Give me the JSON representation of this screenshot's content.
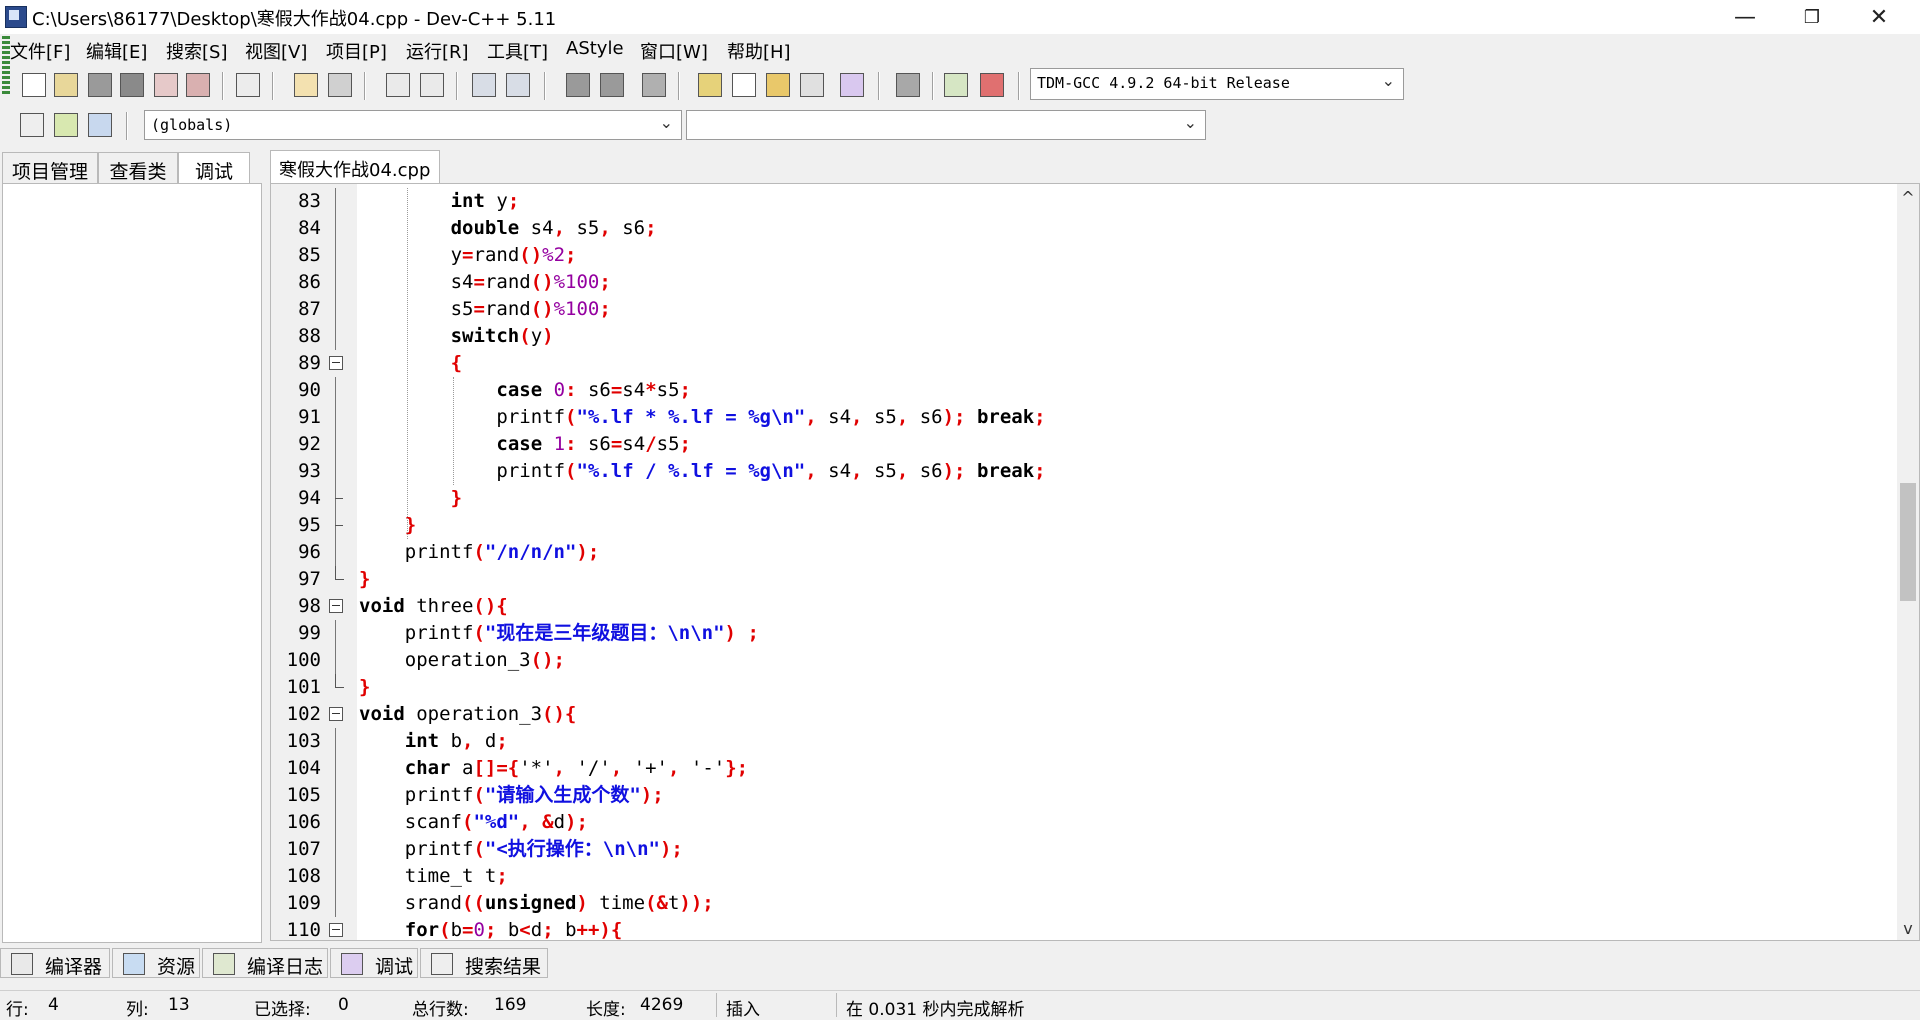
{
  "window": {
    "title": "C:\\Users\\86177\\Desktop\\寒假大作战04.cpp - Dev-C++ 5.11",
    "min_glyph": "—",
    "max_glyph": "❐",
    "close_glyph": "✕"
  },
  "menu": [
    "文件[F]",
    "编辑[E]",
    "搜索[S]",
    "视图[V]",
    "项目[P]",
    "运行[R]",
    "工具[T]",
    "AStyle",
    "窗口[W]",
    "帮助[H]"
  ],
  "toolbar": {
    "compiler_select": "TDM-GCC 4.9.2 64-bit Release",
    "scope_select": "(globals)",
    "member_select": ""
  },
  "left_tabs": [
    "项目管理",
    "查看类",
    "调试"
  ],
  "left_active_tab": 2,
  "editor_tab": "寒假大作战04.cpp",
  "code": [
    {
      "n": "83",
      "t": [
        [
          "kw",
          "int"
        ],
        [
          "id",
          " y"
        ],
        [
          "pu",
          ";"
        ]
      ]
    },
    {
      "n": "84",
      "t": [
        [
          "kw",
          "double"
        ],
        [
          "id",
          " s4"
        ],
        [
          "pu",
          ","
        ],
        [
          "id",
          " s5"
        ],
        [
          "pu",
          ","
        ],
        [
          "id",
          " s6"
        ],
        [
          "pu",
          ";"
        ]
      ]
    },
    {
      "n": "85",
      "t": [
        [
          "id",
          "y"
        ],
        [
          "pu",
          "="
        ],
        [
          "id",
          "rand"
        ],
        [
          "pu",
          "()"
        ],
        [
          "nu",
          "%2"
        ],
        [
          "pu",
          ";"
        ]
      ]
    },
    {
      "n": "86",
      "t": [
        [
          "id",
          "s4"
        ],
        [
          "pu",
          "="
        ],
        [
          "id",
          "rand"
        ],
        [
          "pu",
          "()"
        ],
        [
          "nu",
          "%100"
        ],
        [
          "pu",
          ";"
        ]
      ]
    },
    {
      "n": "87",
      "t": [
        [
          "id",
          "s5"
        ],
        [
          "pu",
          "="
        ],
        [
          "id",
          "rand"
        ],
        [
          "pu",
          "()"
        ],
        [
          "nu",
          "%100"
        ],
        [
          "pu",
          ";"
        ]
      ]
    },
    {
      "n": "88",
      "t": [
        [
          "kw",
          "switch"
        ],
        [
          "pu",
          "("
        ],
        [
          "id",
          "y"
        ],
        [
          "pu",
          ")"
        ]
      ]
    },
    {
      "n": "89",
      "t": [
        [
          "pu",
          "{"
        ]
      ]
    },
    {
      "n": "90",
      "t": [
        [
          "kw",
          "case"
        ],
        [
          "id",
          " "
        ],
        [
          "nu",
          "0"
        ],
        [
          "pu",
          ":"
        ],
        [
          "id",
          " s6"
        ],
        [
          "pu",
          "="
        ],
        [
          "id",
          "s4"
        ],
        [
          "pu",
          "*"
        ],
        [
          "id",
          "s5"
        ],
        [
          "pu",
          ";"
        ]
      ]
    },
    {
      "n": "91",
      "t": [
        [
          "id",
          "printf"
        ],
        [
          "pu",
          "("
        ],
        [
          "st",
          "\"%.lf * %.lf = %g\\n\""
        ],
        [
          "pu",
          ","
        ],
        [
          "id",
          " s4"
        ],
        [
          "pu",
          ","
        ],
        [
          "id",
          " s5"
        ],
        [
          "pu",
          ","
        ],
        [
          "id",
          " s6"
        ],
        [
          "pu",
          ");"
        ],
        [
          "id",
          " "
        ],
        [
          "kw",
          "break"
        ],
        [
          "pu",
          ";"
        ]
      ]
    },
    {
      "n": "92",
      "t": [
        [
          "kw",
          "case"
        ],
        [
          "id",
          " "
        ],
        [
          "nu",
          "1"
        ],
        [
          "pu",
          ":"
        ],
        [
          "id",
          " s6"
        ],
        [
          "pu",
          "="
        ],
        [
          "id",
          "s4"
        ],
        [
          "pu",
          "/"
        ],
        [
          "id",
          "s5"
        ],
        [
          "pu",
          ";"
        ]
      ]
    },
    {
      "n": "93",
      "t": [
        [
          "id",
          "printf"
        ],
        [
          "pu",
          "("
        ],
        [
          "st",
          "\"%.lf / %.lf = %g\\n\""
        ],
        [
          "pu",
          ","
        ],
        [
          "id",
          " s4"
        ],
        [
          "pu",
          ","
        ],
        [
          "id",
          " s5"
        ],
        [
          "pu",
          ","
        ],
        [
          "id",
          " s6"
        ],
        [
          "pu",
          ");"
        ],
        [
          "id",
          " "
        ],
        [
          "kw",
          "break"
        ],
        [
          "pu",
          ";"
        ]
      ]
    },
    {
      "n": "94",
      "t": [
        [
          "pu",
          "}"
        ]
      ]
    },
    {
      "n": "95",
      "t": [
        [
          "pu",
          "}"
        ]
      ]
    },
    {
      "n": "96",
      "t": [
        [
          "id",
          "printf"
        ],
        [
          "pu",
          "("
        ],
        [
          "st",
          "\"/n/n/n\""
        ],
        [
          "pu",
          ");"
        ]
      ]
    },
    {
      "n": "97",
      "t": [
        [
          "pu",
          "}"
        ]
      ]
    },
    {
      "n": "98",
      "t": [
        [
          "kw",
          "void"
        ],
        [
          "id",
          " three"
        ],
        [
          "pu",
          "(){"
        ]
      ]
    },
    {
      "n": "99",
      "t": [
        [
          "id",
          "printf"
        ],
        [
          "pu",
          "("
        ],
        [
          "st",
          "\"现在是三年级题目：\\n\\n\""
        ],
        [
          "pu",
          ")"
        ],
        [
          "id",
          " "
        ],
        [
          "pu",
          ";"
        ]
      ]
    },
    {
      "n": "100",
      "t": [
        [
          "id",
          "operation_3"
        ],
        [
          "pu",
          "();"
        ]
      ]
    },
    {
      "n": "101",
      "t": [
        [
          "pu",
          "}"
        ]
      ]
    },
    {
      "n": "102",
      "t": [
        [
          "kw",
          "void"
        ],
        [
          "id",
          " operation_3"
        ],
        [
          "pu",
          "(){"
        ]
      ]
    },
    {
      "n": "103",
      "t": [
        [
          "kw",
          "int"
        ],
        [
          "id",
          " b"
        ],
        [
          "pu",
          ","
        ],
        [
          "id",
          " d"
        ],
        [
          "pu",
          ";"
        ]
      ]
    },
    {
      "n": "104",
      "t": [
        [
          "kw",
          "char"
        ],
        [
          "id",
          " a"
        ],
        [
          "pu",
          "[]={"
        ],
        [
          "id",
          "'*'"
        ],
        [
          "pu",
          ","
        ],
        [
          "id",
          " '/'"
        ],
        [
          "pu",
          ","
        ],
        [
          "id",
          " '+'"
        ],
        [
          "pu",
          ","
        ],
        [
          "id",
          " '-'"
        ],
        [
          "pu",
          "};"
        ]
      ]
    },
    {
      "n": "105",
      "t": [
        [
          "id",
          "printf"
        ],
        [
          "pu",
          "("
        ],
        [
          "st",
          "\"请输入生成个数\""
        ],
        [
          "pu",
          ");"
        ]
      ]
    },
    {
      "n": "106",
      "t": [
        [
          "id",
          "scanf"
        ],
        [
          "pu",
          "("
        ],
        [
          "st",
          "\"%d\""
        ],
        [
          "pu",
          ","
        ],
        [
          "id",
          " "
        ],
        [
          "pu",
          "&"
        ],
        [
          "id",
          "d"
        ],
        [
          "pu",
          ");"
        ]
      ]
    },
    {
      "n": "107",
      "t": [
        [
          "id",
          "printf"
        ],
        [
          "pu",
          "("
        ],
        [
          "st",
          "\"<执行操作：\\n\\n\""
        ],
        [
          "pu",
          ");"
        ]
      ]
    },
    {
      "n": "108",
      "t": [
        [
          "id",
          "time_t t"
        ],
        [
          "pu",
          ";"
        ]
      ]
    },
    {
      "n": "109",
      "t": [
        [
          "id",
          "srand"
        ],
        [
          "pu",
          "(("
        ],
        [
          "kw",
          "unsigned"
        ],
        [
          "pu",
          ")"
        ],
        [
          "id",
          " time"
        ],
        [
          "pu",
          "(&"
        ],
        [
          "id",
          "t"
        ],
        [
          "pu",
          "));"
        ]
      ]
    },
    {
      "n": "110",
      "t": [
        [
          "kw",
          "for"
        ],
        [
          "pu",
          "("
        ],
        [
          "id",
          "b"
        ],
        [
          "pu",
          "="
        ],
        [
          "nu",
          "0"
        ],
        [
          "pu",
          ";"
        ],
        [
          "id",
          " b"
        ],
        [
          "pu",
          "<"
        ],
        [
          "id",
          "d"
        ],
        [
          "pu",
          ";"
        ],
        [
          "id",
          " b"
        ],
        [
          "pu",
          "++){"
        ]
      ]
    }
  ],
  "scrollbar": {
    "position": 0.389,
    "visible_fraction": 0.166
  },
  "bottom_tabs": [
    "编译器",
    "资源",
    "编译日志",
    "调试",
    "搜索结果"
  ],
  "status": {
    "line_label": "行:",
    "line_value": "4",
    "col_label": "列:",
    "col_value": "13",
    "sel_label": "已选择:",
    "sel_value": "0",
    "total_label": "总行数:",
    "total_value": "169",
    "len_label": "长度:",
    "len_value": "4269",
    "mode": "插入",
    "parse_msg": "在 0.031 秒内完成解析"
  }
}
